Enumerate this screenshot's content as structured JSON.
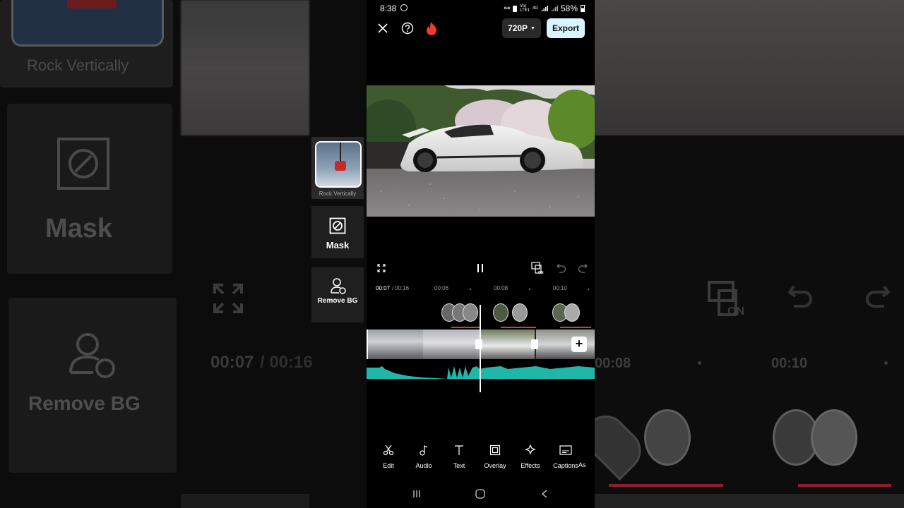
{
  "status_bar": {
    "time": "8:38",
    "battery": "58%",
    "icons": [
      "circle-record-icon",
      "link-icon",
      "lock-icon",
      "volte-icon",
      "4g-icon",
      "signal-icon",
      "battery-icon"
    ]
  },
  "top_bar": {
    "close_icon": "close-icon",
    "help_icon": "help-icon",
    "fire_icon": "fire-icon",
    "resolution": "720P",
    "export_label": "Export"
  },
  "playback": {
    "current_time": "00:07",
    "total_time": "00:16",
    "timeline_marks": [
      "00:06",
      "00:08",
      "00:10"
    ]
  },
  "side_panel": {
    "items": [
      {
        "label": "Rock Vertically"
      },
      {
        "label": "Mask"
      },
      {
        "label": "Remove BG"
      }
    ]
  },
  "toolbar": {
    "items": [
      {
        "label": "Edit",
        "icon": "scissors-icon"
      },
      {
        "label": "Audio",
        "icon": "music-note-icon"
      },
      {
        "label": "Text",
        "icon": "text-icon"
      },
      {
        "label": "Overlay",
        "icon": "overlay-icon"
      },
      {
        "label": "Effects",
        "icon": "sparkle-icon"
      },
      {
        "label": "Captions",
        "icon": "captions-icon"
      },
      {
        "label": "As"
      }
    ]
  },
  "background_zoom": {
    "rock_label": "Rock Vertically",
    "mask_label": "Mask",
    "remove_bg_label": "Remove BG",
    "time_current": "00:07",
    "time_total": "/ 00:16",
    "mark_a": "00:08",
    "mark_b": "00:10"
  },
  "colors": {
    "accent_audio": "#1fb8a8",
    "export_bg": "#d8f5ff",
    "keyframe_line": "#d33a4e"
  }
}
